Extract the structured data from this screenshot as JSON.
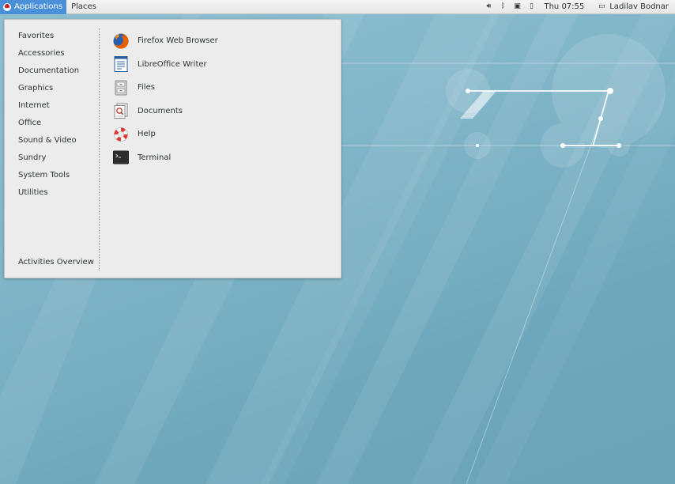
{
  "panel": {
    "applications_label": "Applications",
    "places_label": "Places",
    "clock": "Thu 07:55",
    "user_name": "Ladilav Bodnar",
    "tray_icons": [
      "volume-icon",
      "bluetooth-icon",
      "network-icon",
      "battery-icon"
    ]
  },
  "menu": {
    "categories": [
      {
        "label": "Favorites"
      },
      {
        "label": "Accessories"
      },
      {
        "label": "Documentation"
      },
      {
        "label": "Graphics"
      },
      {
        "label": "Internet"
      },
      {
        "label": "Office"
      },
      {
        "label": "Sound & Video"
      },
      {
        "label": "Sundry"
      },
      {
        "label": "System Tools"
      },
      {
        "label": "Utilities"
      }
    ],
    "activities_overview": "Activities Overview",
    "apps": [
      {
        "label": "Firefox Web Browser",
        "icon": "firefox-icon"
      },
      {
        "label": "LibreOffice Writer",
        "icon": "libreoffice-writer-icon"
      },
      {
        "label": "Files",
        "icon": "files-icon"
      },
      {
        "label": "Documents",
        "icon": "documents-icon"
      },
      {
        "label": "Help",
        "icon": "help-lifebuoy-icon"
      },
      {
        "label": "Terminal",
        "icon": "terminal-icon"
      }
    ]
  },
  "colors": {
    "accent": "#4a90d9",
    "panel_bg": "#ececec",
    "menu_bg": "#ececec",
    "desktop_bg": "#7fb3c7",
    "text": "#2e3436"
  }
}
